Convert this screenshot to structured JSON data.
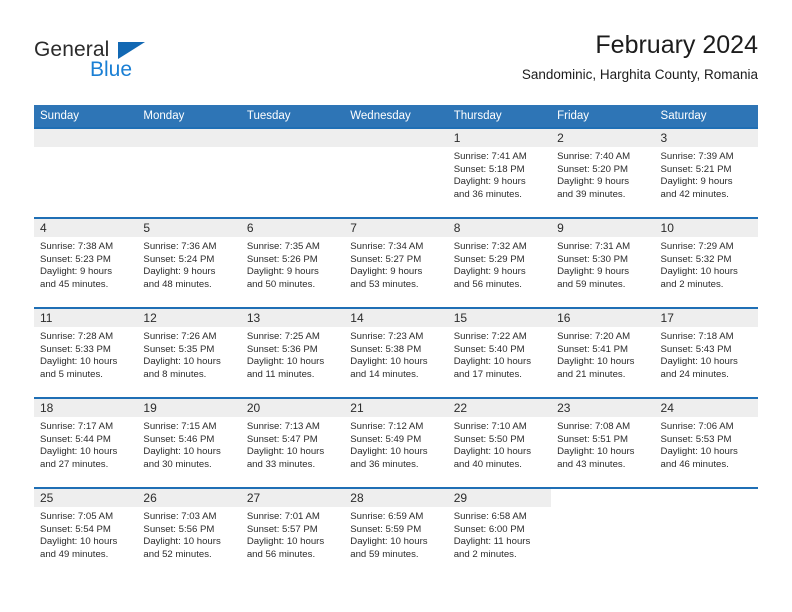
{
  "brand": {
    "name_primary": "General",
    "name_secondary": "Blue",
    "triangle_color": "#1268b3",
    "blue_color": "#1a7fd4"
  },
  "header": {
    "title": "February 2024",
    "subtitle": "Sandominic, Harghita County, Romania"
  },
  "theme": {
    "header_bg": "#2e75b6",
    "row_divider": "#1f6fb5",
    "daynum_band_bg": "#eeeeee",
    "text": "#2b2b2b"
  },
  "weekday_headers": [
    "Sunday",
    "Monday",
    "Tuesday",
    "Wednesday",
    "Thursday",
    "Friday",
    "Saturday"
  ],
  "weeks": [
    [
      {
        "day": "",
        "lines": []
      },
      {
        "day": "",
        "lines": []
      },
      {
        "day": "",
        "lines": []
      },
      {
        "day": "",
        "lines": []
      },
      {
        "day": "1",
        "lines": [
          "Sunrise: 7:41 AM",
          "Sunset: 5:18 PM",
          "Daylight: 9 hours",
          "and 36 minutes."
        ]
      },
      {
        "day": "2",
        "lines": [
          "Sunrise: 7:40 AM",
          "Sunset: 5:20 PM",
          "Daylight: 9 hours",
          "and 39 minutes."
        ]
      },
      {
        "day": "3",
        "lines": [
          "Sunrise: 7:39 AM",
          "Sunset: 5:21 PM",
          "Daylight: 9 hours",
          "and 42 minutes."
        ]
      }
    ],
    [
      {
        "day": "4",
        "lines": [
          "Sunrise: 7:38 AM",
          "Sunset: 5:23 PM",
          "Daylight: 9 hours",
          "and 45 minutes."
        ]
      },
      {
        "day": "5",
        "lines": [
          "Sunrise: 7:36 AM",
          "Sunset: 5:24 PM",
          "Daylight: 9 hours",
          "and 48 minutes."
        ]
      },
      {
        "day": "6",
        "lines": [
          "Sunrise: 7:35 AM",
          "Sunset: 5:26 PM",
          "Daylight: 9 hours",
          "and 50 minutes."
        ]
      },
      {
        "day": "7",
        "lines": [
          "Sunrise: 7:34 AM",
          "Sunset: 5:27 PM",
          "Daylight: 9 hours",
          "and 53 minutes."
        ]
      },
      {
        "day": "8",
        "lines": [
          "Sunrise: 7:32 AM",
          "Sunset: 5:29 PM",
          "Daylight: 9 hours",
          "and 56 minutes."
        ]
      },
      {
        "day": "9",
        "lines": [
          "Sunrise: 7:31 AM",
          "Sunset: 5:30 PM",
          "Daylight: 9 hours",
          "and 59 minutes."
        ]
      },
      {
        "day": "10",
        "lines": [
          "Sunrise: 7:29 AM",
          "Sunset: 5:32 PM",
          "Daylight: 10 hours",
          "and 2 minutes."
        ]
      }
    ],
    [
      {
        "day": "11",
        "lines": [
          "Sunrise: 7:28 AM",
          "Sunset: 5:33 PM",
          "Daylight: 10 hours",
          "and 5 minutes."
        ]
      },
      {
        "day": "12",
        "lines": [
          "Sunrise: 7:26 AM",
          "Sunset: 5:35 PM",
          "Daylight: 10 hours",
          "and 8 minutes."
        ]
      },
      {
        "day": "13",
        "lines": [
          "Sunrise: 7:25 AM",
          "Sunset: 5:36 PM",
          "Daylight: 10 hours",
          "and 11 minutes."
        ]
      },
      {
        "day": "14",
        "lines": [
          "Sunrise: 7:23 AM",
          "Sunset: 5:38 PM",
          "Daylight: 10 hours",
          "and 14 minutes."
        ]
      },
      {
        "day": "15",
        "lines": [
          "Sunrise: 7:22 AM",
          "Sunset: 5:40 PM",
          "Daylight: 10 hours",
          "and 17 minutes."
        ]
      },
      {
        "day": "16",
        "lines": [
          "Sunrise: 7:20 AM",
          "Sunset: 5:41 PM",
          "Daylight: 10 hours",
          "and 21 minutes."
        ]
      },
      {
        "day": "17",
        "lines": [
          "Sunrise: 7:18 AM",
          "Sunset: 5:43 PM",
          "Daylight: 10 hours",
          "and 24 minutes."
        ]
      }
    ],
    [
      {
        "day": "18",
        "lines": [
          "Sunrise: 7:17 AM",
          "Sunset: 5:44 PM",
          "Daylight: 10 hours",
          "and 27 minutes."
        ]
      },
      {
        "day": "19",
        "lines": [
          "Sunrise: 7:15 AM",
          "Sunset: 5:46 PM",
          "Daylight: 10 hours",
          "and 30 minutes."
        ]
      },
      {
        "day": "20",
        "lines": [
          "Sunrise: 7:13 AM",
          "Sunset: 5:47 PM",
          "Daylight: 10 hours",
          "and 33 minutes."
        ]
      },
      {
        "day": "21",
        "lines": [
          "Sunrise: 7:12 AM",
          "Sunset: 5:49 PM",
          "Daylight: 10 hours",
          "and 36 minutes."
        ]
      },
      {
        "day": "22",
        "lines": [
          "Sunrise: 7:10 AM",
          "Sunset: 5:50 PM",
          "Daylight: 10 hours",
          "and 40 minutes."
        ]
      },
      {
        "day": "23",
        "lines": [
          "Sunrise: 7:08 AM",
          "Sunset: 5:51 PM",
          "Daylight: 10 hours",
          "and 43 minutes."
        ]
      },
      {
        "day": "24",
        "lines": [
          "Sunrise: 7:06 AM",
          "Sunset: 5:53 PM",
          "Daylight: 10 hours",
          "and 46 minutes."
        ]
      }
    ],
    [
      {
        "day": "25",
        "lines": [
          "Sunrise: 7:05 AM",
          "Sunset: 5:54 PM",
          "Daylight: 10 hours",
          "and 49 minutes."
        ]
      },
      {
        "day": "26",
        "lines": [
          "Sunrise: 7:03 AM",
          "Sunset: 5:56 PM",
          "Daylight: 10 hours",
          "and 52 minutes."
        ]
      },
      {
        "day": "27",
        "lines": [
          "Sunrise: 7:01 AM",
          "Sunset: 5:57 PM",
          "Daylight: 10 hours",
          "and 56 minutes."
        ]
      },
      {
        "day": "28",
        "lines": [
          "Sunrise: 6:59 AM",
          "Sunset: 5:59 PM",
          "Daylight: 10 hours",
          "and 59 minutes."
        ]
      },
      {
        "day": "29",
        "lines": [
          "Sunrise: 6:58 AM",
          "Sunset: 6:00 PM",
          "Daylight: 11 hours",
          "and 2 minutes."
        ]
      },
      {
        "day": "",
        "lines": []
      },
      {
        "day": "",
        "lines": []
      }
    ]
  ]
}
